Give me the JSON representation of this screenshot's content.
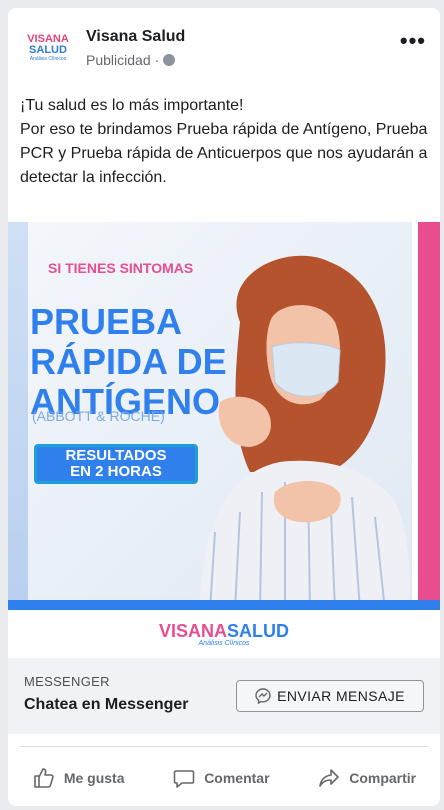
{
  "post": {
    "page_name": "Visana Salud",
    "sponsored_label": "Publicidad",
    "separator": "·",
    "body": "¡Tu salud es lo más importante!\nPor eso te brindamos Prueba rápida de Antígeno, Prueba PCR y Prueba rápida de Anticuerpos que nos ayudarán a detectar la infección."
  },
  "avatar_logo": {
    "line1": "VISANA",
    "line2": "SALUD",
    "line3": "Análisis Clínicos"
  },
  "ad": {
    "tag": "SI TIENES SINTOMAS",
    "headline": "PRUEBA\nRÁPIDA DE\nANTÍGENO",
    "brands": "(ABBOTT & ROCHE)",
    "result": "RESULTADOS\nEN 2 HORAS",
    "logo_part1": "VISANA",
    "logo_part2": "SALUD",
    "logo_sub": "Análisis Clínicos",
    "colors": {
      "pink": "#e74d8f",
      "blue": "#2f80ed"
    }
  },
  "cta": {
    "channel": "MESSENGER",
    "headline": "Chatea en Messenger",
    "button_label": "ENVIAR MENSAJE",
    "button_icon": "messenger-icon"
  },
  "actions": [
    {
      "label": "Me gusta",
      "icon": "like-icon"
    },
    {
      "label": "Comentar",
      "icon": "comment-icon"
    },
    {
      "label": "Compartir",
      "icon": "share-icon"
    }
  ]
}
